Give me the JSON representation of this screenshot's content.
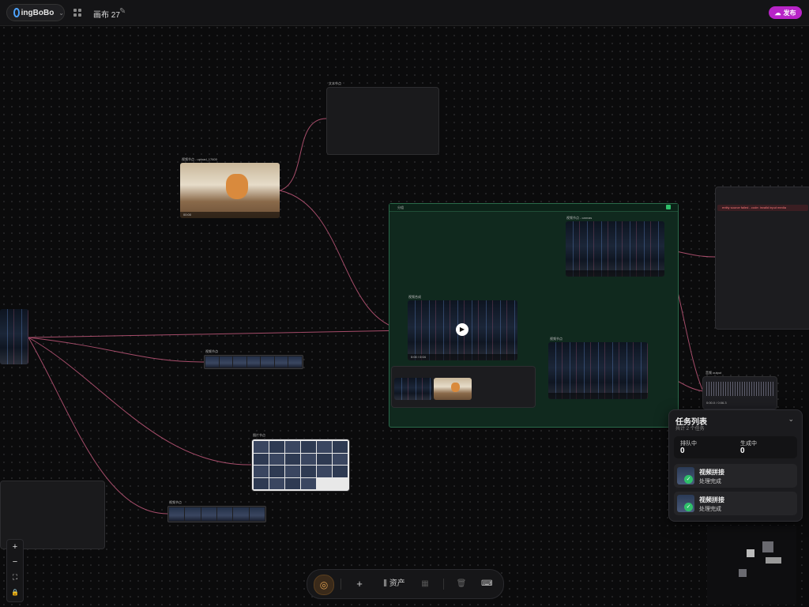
{
  "topbar": {
    "logo_text": "ingBoBo",
    "canvas_title": "画布 27",
    "publish_label": "发布"
  },
  "nodes": {
    "text_node_label": "文本节点",
    "cat_video_label": "视频节点 - upload_17600",
    "group_label": "分组",
    "strip1_label": "视频节点",
    "grid_label": "图片节点",
    "strip2_label": "视频节点",
    "video_top_label": "视频节点 - canvas",
    "video_mid_label": "视频合成",
    "video_bottom_label": "视频节点",
    "audio_label": "音频 output",
    "cat_time": "00:00",
    "play_time": "0:00 / 0:04",
    "audio_time": "0:00.0 / 0:06.3"
  },
  "right_panel": {
    "error_text": "entity source failed - code: invalid input media"
  },
  "tasks": {
    "title": "任务列表",
    "subtitle": "共计 2 个任务",
    "queued_label": "排队中",
    "queued_value": "0",
    "generating_label": "生成中",
    "generating_value": "0",
    "items": [
      {
        "name": "视频拼接",
        "status": "处理完成"
      },
      {
        "name": "视频拼接",
        "status": "处理完成"
      }
    ]
  },
  "toolbar": {
    "add": "+",
    "assets": "资产"
  },
  "zoom": {
    "zoom_in": "+",
    "zoom_out": "−"
  },
  "colors": {
    "accent_publish": "#b824c7",
    "group_bg": "#10291e",
    "wire": "#c0587a",
    "success": "#2fbf6a"
  }
}
